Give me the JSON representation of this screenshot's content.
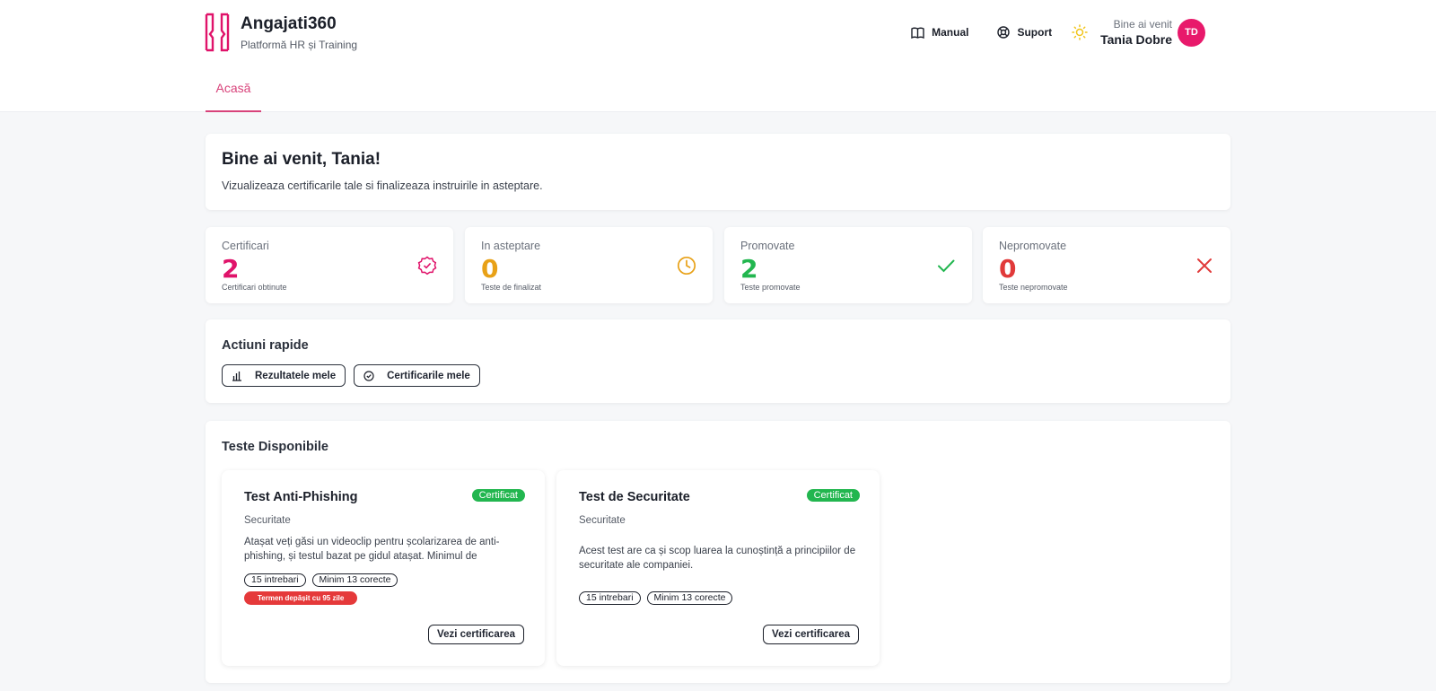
{
  "brand": {
    "title": "Angajati360",
    "subtitle": "Platformă HR și Training"
  },
  "topnav": {
    "manual": "Manual",
    "support": "Suport",
    "welcome": "Bine ai venit",
    "user_name": "Tania Dobre",
    "initials": "TD"
  },
  "tabs": [
    {
      "label": "Acasă",
      "active": true
    }
  ],
  "welcome": {
    "title": "Bine ai venit, Tania!",
    "text": "Vizualizeaza certificarile tale si finalizeaza instruirile in asteptare."
  },
  "stats": [
    {
      "label": "Certificari",
      "value": "2",
      "sub": "Certificari obtinute",
      "color": "#e0136a",
      "icon": "certificate-icon"
    },
    {
      "label": "In asteptare",
      "value": "0",
      "sub": "Teste de finalizat",
      "color": "#e8a117",
      "icon": "clock-icon"
    },
    {
      "label": "Promovate",
      "value": "2",
      "sub": "Teste promovate",
      "color": "#22b64f",
      "icon": "check-icon"
    },
    {
      "label": "Nepromovate",
      "value": "0",
      "sub": "Teste nepromovate",
      "color": "#e13a3a",
      "icon": "x-icon"
    }
  ],
  "quick": {
    "title": "Actiuni rapide",
    "results": "Rezultatele mele",
    "certificates": "Certificarile mele"
  },
  "tests": {
    "title": "Teste Disponibile",
    "items": [
      {
        "title": "Test Anti-Phishing",
        "badge": "Certificat",
        "category": "Securitate",
        "description": "Atașat veți găsi un videoclip pentru școlarizarea de anti-phishing, și testul bazat pe gidul atașat. Minimul de răspunsuri corecte la...",
        "questions": "15 intrebari",
        "min": "Minim 13 corecte",
        "overdue": "Termen depășit cu 95 zile",
        "button": "Vezi certificarea"
      },
      {
        "title": "Test de Securitate",
        "badge": "Certificat",
        "category": "Securitate",
        "description": "Acest test are ca și scop luarea la cunoștință a principiilor de securitate ale  companiei.",
        "questions": "15 intrebari",
        "min": "Minim 13 corecte",
        "button": "Vezi certificarea"
      }
    ]
  },
  "colors": {
    "accent": "#e8196b",
    "tab": "#d8427a",
    "badge": "#22b64f",
    "overdue": "#e5393a"
  }
}
